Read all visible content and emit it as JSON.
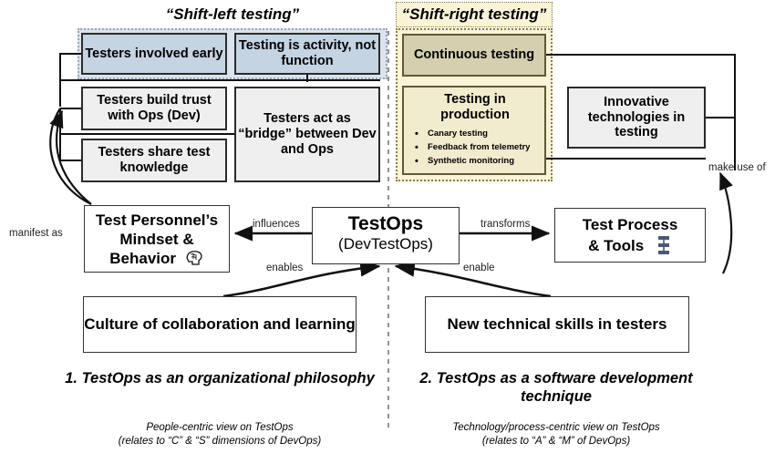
{
  "diagram": {
    "groups": {
      "left": {
        "title": "“Shift-left testing”"
      },
      "right": {
        "title": "“Shift-right testing”"
      }
    },
    "shift_left_boxes": [
      {
        "label": "Testers involved early",
        "style": "blue"
      },
      {
        "label": "Testing is activity, not function",
        "style": "blue"
      },
      {
        "label": "Testers build trust with Ops (Dev)",
        "style": "gray"
      },
      {
        "label": "Testers share test knowledge",
        "style": "gray"
      },
      {
        "label": "Testers act as “bridge” between Dev and Ops",
        "style": "gray"
      }
    ],
    "shift_right_boxes": [
      {
        "label": "Continuous testing",
        "style": "olive"
      },
      {
        "label": "Testing in production",
        "style": "cream",
        "bullets": [
          "Canary testing",
          "Feedback from telemetry",
          "Synthetic monitoring"
        ]
      }
    ],
    "innovative_box": {
      "label": "Innovative technologies in testing",
      "style": "gray"
    },
    "center": {
      "mindset": {
        "line1": "Test Personnel’s",
        "line2": "Mindset &",
        "line3": "Behavior",
        "icon": "head-brain-icon"
      },
      "testops": {
        "title": "TestOps",
        "subtitle": "(DevTestOps)"
      },
      "process_tools": {
        "line1": "Test Process",
        "line2": "& Tools",
        "icon": "hierarchy-network-icon"
      }
    },
    "bottom": {
      "culture": {
        "label": "Culture of collaboration and learning"
      },
      "skills": {
        "label": "New technical skills in testers"
      }
    },
    "captions": {
      "left_title": "1. TestOps as an organizational philosophy",
      "left_sub": "People-centric view on TestOps\n(relates to “C” & “S” dimensions of DevOps)",
      "left_sub_line1": "People-centric view on TestOps",
      "left_sub_line2": "(relates to “C” & “S” dimensions of DevOps)",
      "right_title": "2. TestOps as a software development technique",
      "right_sub_line1": "Technology/process-centric view on TestOps",
      "right_sub_line2": "(relates to “A” & “M” of DevOps)"
    },
    "edge_labels": {
      "manifest_as": "manifest as",
      "influences": "influences",
      "enables": "enables",
      "transforms": "transforms",
      "enable": "enable",
      "make_use_of": "make use of"
    },
    "colors": {
      "blue_fill": "#c5d4e3",
      "gray_fill": "#efefef",
      "olive_fill": "#d3cfaf",
      "cream_fill": "#f2ecce",
      "left_group_fill": "#dbe4ee",
      "right_group_fill": "#faf3d8",
      "icon_slate": "#4a5a72",
      "stroke": "#2b2b2b"
    }
  }
}
